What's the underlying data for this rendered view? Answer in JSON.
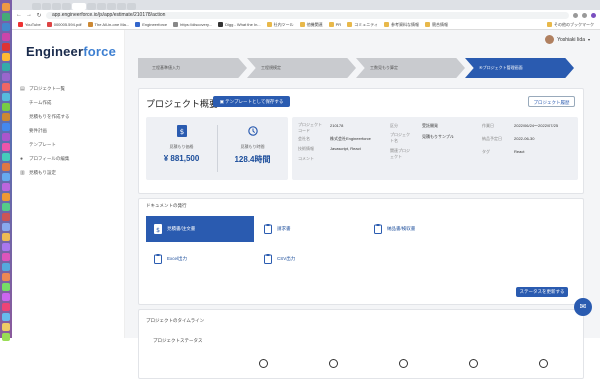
{
  "browser": {
    "url": "app.engineerforce.io/js/app/estimate/210178/action",
    "bookmarks": [
      "YouTube",
      "000005.594.pdf",
      "The All-in-one Ma...",
      "Engineerforce",
      "https://discovery...",
      "Digg - What the In...",
      "社内ツール",
      "他機関連",
      "PR",
      "コミュニティ",
      "参考資料な情報",
      "競合情報"
    ],
    "bookmarks_right": "その他のブックマーク"
  },
  "sidebar": {
    "logo_a": "Engineer",
    "logo_b": "force",
    "items": [
      {
        "label": "プロジェクト一覧",
        "icon": "folder-icon"
      },
      {
        "label": "チーム作成",
        "icon": ""
      },
      {
        "label": "見積もりを作成する",
        "icon": ""
      },
      {
        "label": "要件計画",
        "icon": ""
      },
      {
        "label": "テンプレート",
        "icon": ""
      },
      {
        "label": "プロフィールの編集",
        "icon": "person-icon"
      },
      {
        "label": "見積もり設定",
        "icon": "book-icon"
      }
    ]
  },
  "header": {
    "user_name": "Yoshiaki Iida"
  },
  "steps": [
    "工程基準値入力",
    "工程規模定",
    "工数見もり算定",
    "④プロジェクト管理画面"
  ],
  "overview": {
    "title": "プロジェクト概要",
    "template_button": "テンプレートとして保存する",
    "project_button": "プロジェクト履歴",
    "kpis": [
      {
        "label": "見積もり価格",
        "value": "¥ 881,500",
        "icon": "yen-doc-icon"
      },
      {
        "label": "見積もり時間",
        "value": "128.4時間",
        "icon": "clock-icon"
      }
    ],
    "info": [
      {
        "label": "プロジェクトコード",
        "value": "210178"
      },
      {
        "label": "会社名",
        "value": "株式会社Engineerforce"
      },
      {
        "label": "技術情報",
        "value": "Javascript, React"
      },
      {
        "label": "コメント",
        "value": ""
      },
      {
        "label": "区分",
        "value": "受託開発"
      },
      {
        "label": "プロジェクト名",
        "value": "見積もりサンプル"
      },
      {
        "label": "関連プロジェクト",
        "value": ""
      },
      {
        "label": "作業日",
        "value": "2022/06/24〜2022/07/25"
      },
      {
        "label": "納品予定日",
        "value": "2022-06-30"
      },
      {
        "label": "タグ",
        "value": "React"
      }
    ]
  },
  "documents": {
    "title": "ドキュメントの発行",
    "items": [
      "見積書/注文書",
      "請求書",
      "納品書/検収書",
      "Excel出力",
      "CSV出力"
    ]
  },
  "timeline": {
    "title": "プロジェクトのタイムライン",
    "status_button": "ステータスを更新する",
    "subtitle": "プロジェクトステータス"
  },
  "colors": {
    "primary": "#2a5bb0",
    "step_inactive": "#c9cbcf"
  }
}
